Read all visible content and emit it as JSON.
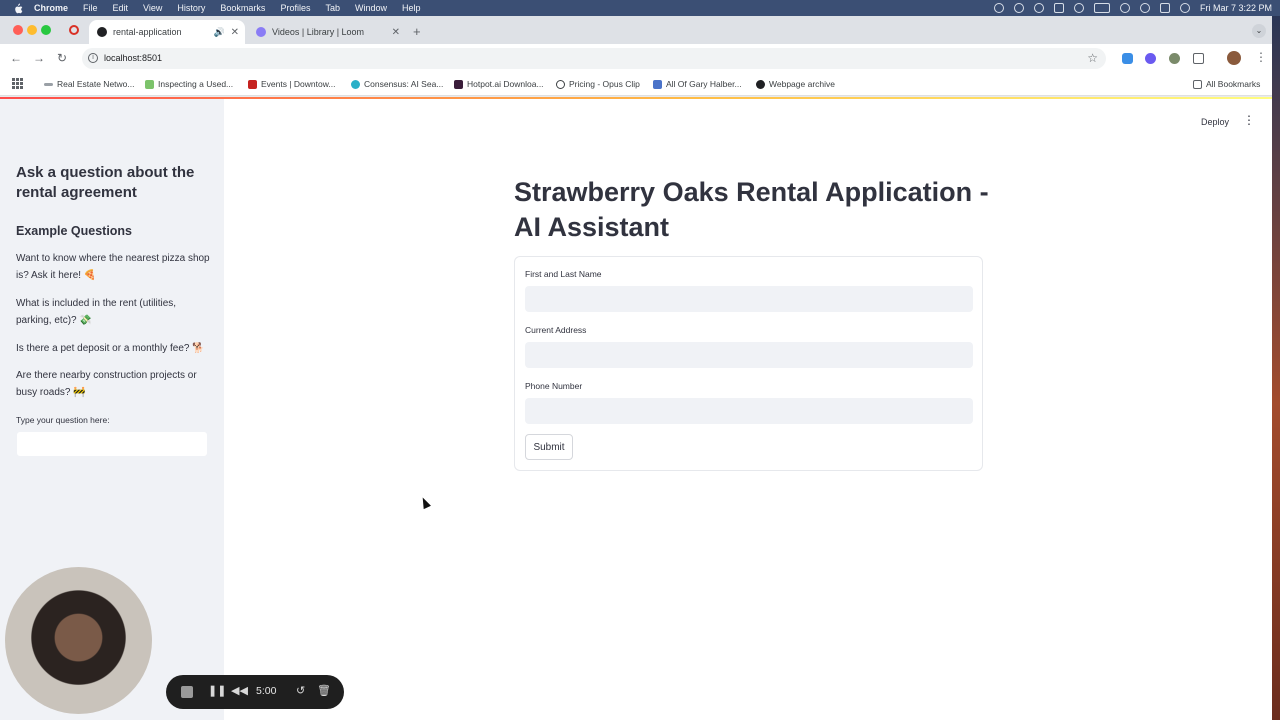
{
  "menubar": {
    "app": "Chrome",
    "items": [
      "File",
      "Edit",
      "View",
      "History",
      "Bookmarks",
      "Profiles",
      "Tab",
      "Window",
      "Help"
    ],
    "datetime": "Fri Mar 7  3:22 PM"
  },
  "tabs": [
    {
      "label": "rental-application",
      "active": true
    },
    {
      "label": "Videos | Library | Loom",
      "active": false
    }
  ],
  "address": {
    "url": "localhost:8501"
  },
  "bookmarks": {
    "items": [
      "Real Estate Netwo...",
      "Inspecting a Used...",
      "Events | Downtow...",
      "Consensus: AI Sea...",
      "Hotpot.ai Downloa...",
      "Pricing - Opus Clip",
      "All Of Gary Halber...",
      "Webpage archive"
    ],
    "all_label": "All Bookmarks"
  },
  "app_header": {
    "deploy_label": "Deploy"
  },
  "sidebar": {
    "title": "Ask a question about the rental agreement",
    "subtitle": "Example Questions",
    "questions": [
      "Want to know where the nearest pizza shop is? Ask it here! 🍕",
      "What is included in the rent (utilities, parking, etc)? 💸",
      "Is there a pet deposit or a monthly fee? 🐕",
      "Are there nearby construction projects or busy roads? 🚧"
    ],
    "input_label": "Type your question here:",
    "input_value": ""
  },
  "main": {
    "title": "Strawberry Oaks Rental Application - AI Assistant",
    "form": {
      "fields": [
        {
          "label": "First and Last Name",
          "value": ""
        },
        {
          "label": "Current Address",
          "value": ""
        },
        {
          "label": "Phone Number",
          "value": ""
        }
      ],
      "submit_label": "Submit"
    }
  },
  "recorder": {
    "time": "5:00"
  }
}
